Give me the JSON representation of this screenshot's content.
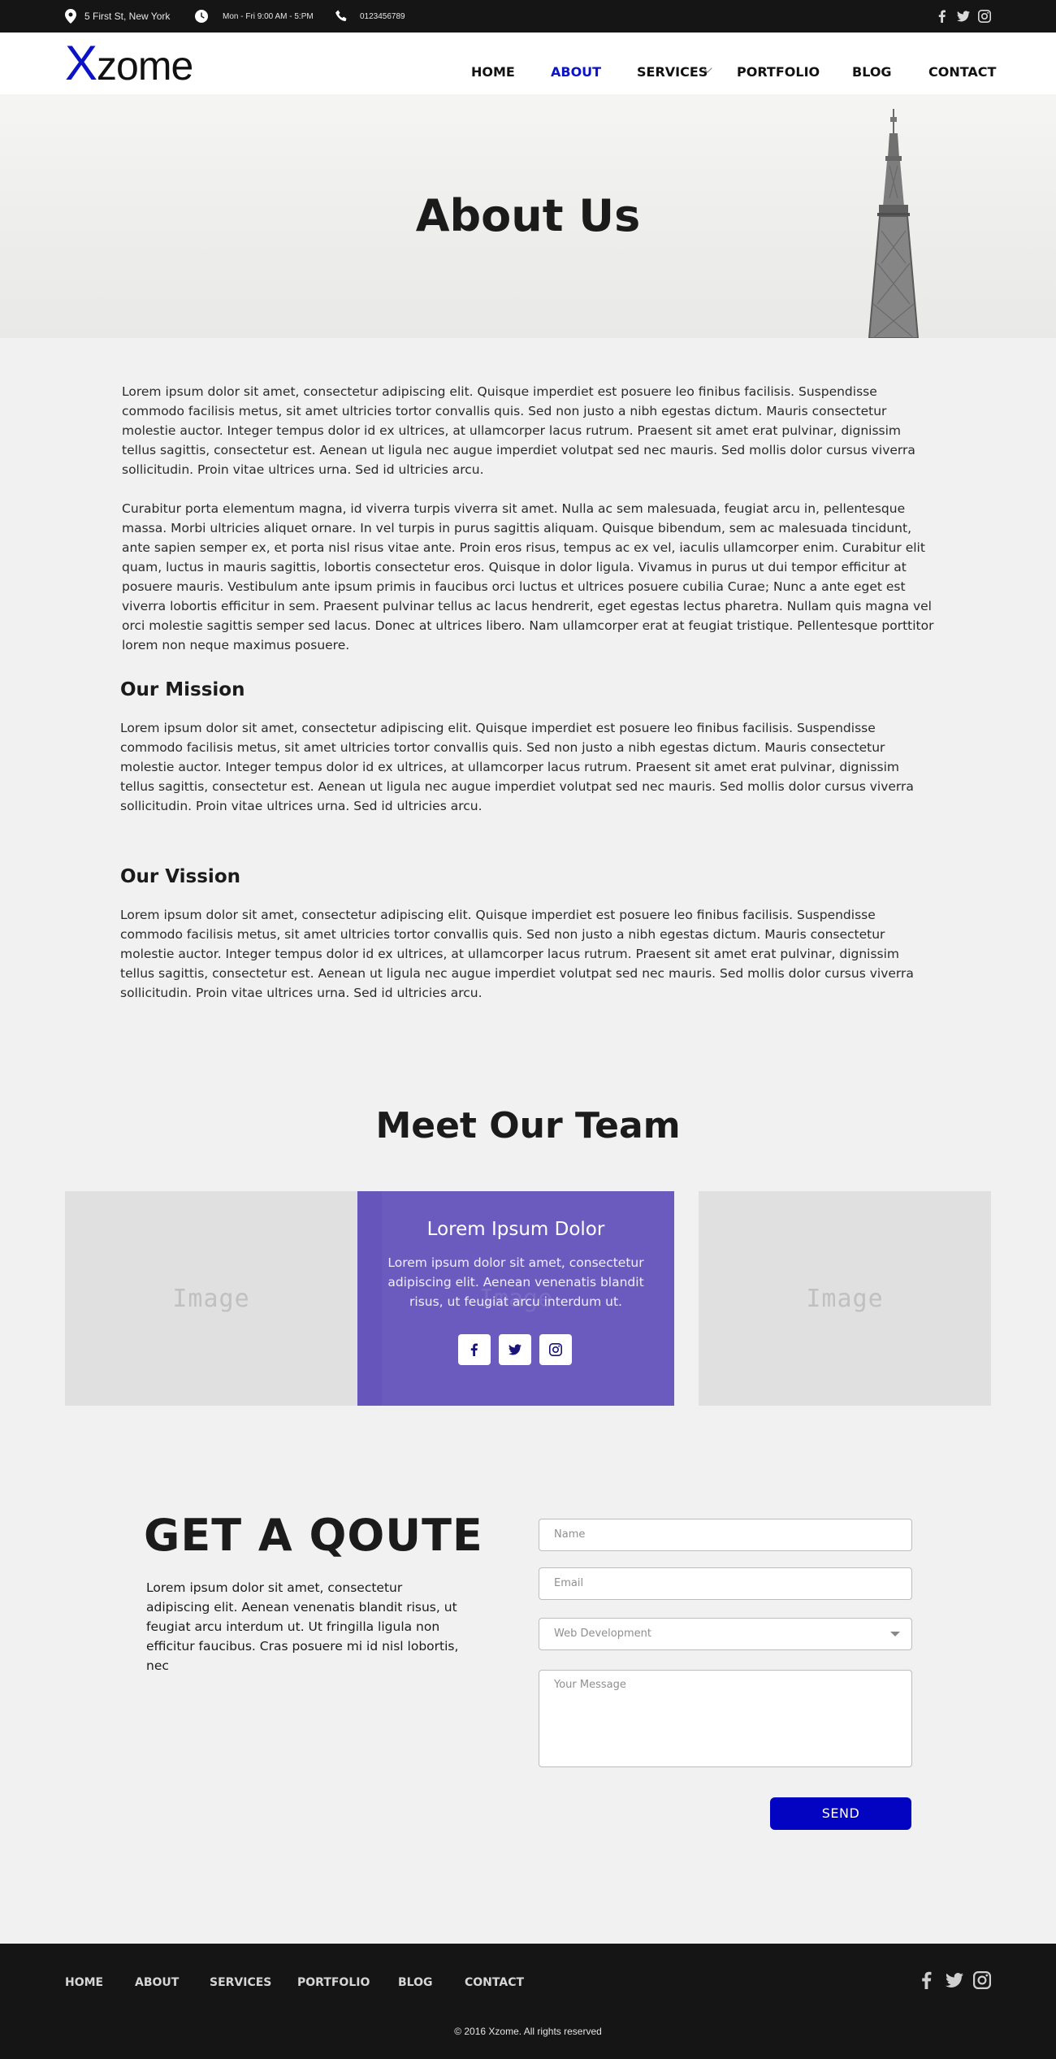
{
  "topbar": {
    "address": "5 First St, New York",
    "hours": "Mon - Fri 9:00 AM - 5:PM",
    "phone": "0123456789",
    "icons": [
      "location-pin-icon",
      "clock-icon",
      "phone-icon",
      "facebook-icon",
      "twitter-icon",
      "instagram-icon"
    ]
  },
  "brand": {
    "logo_x": "X",
    "logo_rest": "zome",
    "accent": "#0a13c7"
  },
  "nav": {
    "home": "HOME",
    "about": "ABOUT",
    "services": "SERVICES",
    "portfolio": "PORTFOLIO",
    "blog": "BLOG",
    "contact": "CONTACT",
    "active": "ABOUT"
  },
  "hero": {
    "title": "About Us"
  },
  "about": {
    "p1": "Lorem ipsum dolor sit amet, consectetur adipiscing elit. Quisque imperdiet est posuere leo finibus facilisis. Suspendisse commodo facilisis metus, sit amet ultricies tortor convallis quis. Sed non justo a nibh egestas dictum. Mauris consectetur molestie auctor. Integer tempus dolor id ex ultrices, at ullamcorper lacus rutrum. Praesent sit amet erat pulvinar, dignissim tellus sagittis, consectetur est. Aenean ut ligula nec augue imperdiet volutpat sed nec mauris. Sed mollis dolor cursus viverra sollicitudin. Proin vitae ultrices urna. Sed id ultricies arcu.",
    "p2": "Curabitur porta elementum magna, id viverra turpis viverra sit amet. Nulla ac sem malesuada, feugiat arcu in, pellentesque massa. Morbi ultricies aliquet ornare. In vel turpis in purus sagittis aliquam. Quisque bibendum, sem ac malesuada tincidunt, ante sapien semper ex, et porta nisl risus vitae ante. Proin eros risus, tempus ac ex vel, iaculis ullamcorper enim. Curabitur elit quam, luctus in mauris sagittis, lobortis consectetur eros. Quisque in dolor ligula. Vivamus in purus ut dui tempor efficitur at posuere mauris. Vestibulum ante ipsum primis in faucibus orci luctus et ultrices posuere cubilia Curae; Nunc a ante eget est viverra lobortis efficitur in sem. Praesent pulvinar tellus ac lacus hendrerit, eget egestas lectus pharetra. Nullam quis magna vel orci molestie sagittis semper sed lacus. Donec at ultrices libero. Nam ullamcorper erat at feugiat tristique. Pellentesque porttitor lorem non neque maximus posuere."
  },
  "mission": {
    "title": "Our Mission",
    "text": "Lorem ipsum dolor sit amet, consectetur adipiscing elit. Quisque imperdiet est posuere leo finibus facilisis. Suspendisse commodo facilisis metus, sit amet ultricies tortor convallis quis. Sed non justo a nibh egestas dictum. Mauris consectetur molestie auctor. Integer tempus dolor id ex ultrices, at ullamcorper lacus rutrum. Praesent sit amet erat pulvinar, dignissim tellus sagittis, consectetur est. Aenean ut ligula nec augue imperdiet volutpat sed nec mauris. Sed mollis dolor cursus viverra sollicitudin. Proin vitae ultrices urna. Sed id ultricies arcu."
  },
  "vission": {
    "title": "Our Vission",
    "text": "Lorem ipsum dolor sit amet, consectetur adipiscing elit. Quisque imperdiet est posuere leo finibus facilisis. Suspendisse commodo facilisis metus, sit amet ultricies tortor convallis quis. Sed non justo a nibh egestas dictum. Mauris consectetur molestie auctor. Integer tempus dolor id ex ultrices, at ullamcorper lacus rutrum. Praesent sit amet erat pulvinar, dignissim tellus sagittis, consectetur est. Aenean ut ligula nec augue imperdiet volutpat sed nec mauris. Sed mollis dolor cursus viverra sollicitudin. Proin vitae ultrices urna. Sed id ultricies arcu."
  },
  "team": {
    "title": "Meet Our Team",
    "placeholder": "Image",
    "member_name": "Lorem Ipsum Dolor",
    "member_text": "Lorem ipsum dolor sit amet, consectetur adipiscing elit. Aenean venenatis blandit risus, ut feugiat arcu interdum ut.",
    "card_color": "#6b5bbf"
  },
  "quote": {
    "title": "GET A QOUTE",
    "text": "Lorem ipsum dolor sit amet, consectetur adipiscing elit. Aenean venenatis blandit risus, ut feugiat arcu interdum ut. Ut fringilla ligula non efficitur faucibus. Cras posuere mi id nisl lobortis, nec",
    "name_placeholder": "Name",
    "email_placeholder": "Email",
    "service_selected": "Web Development",
    "message_placeholder": "Your Message",
    "send_label": "SEND",
    "send_color": "#0303c2"
  },
  "footer": {
    "nav": [
      "HOME",
      "ABOUT",
      "SERVICES",
      "PORTFOLIO",
      "BLOG",
      "CONTACT"
    ],
    "copyright": "© 2016 Xzome. All rights reserved"
  }
}
